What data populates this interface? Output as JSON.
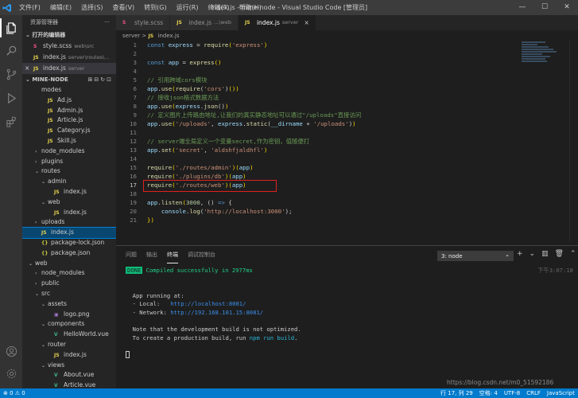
{
  "titlebar": {
    "menu": [
      "文件(F)",
      "编辑(E)",
      "选择(S)",
      "查看(V)",
      "转到(G)",
      "运行(R)",
      "终端(T)",
      "帮助(H)"
    ],
    "title": "index.js - mine-node - Visual Studio Code [管理员]",
    "controls": [
      "—",
      "☐",
      "✕"
    ]
  },
  "activity_icons": [
    "files-icon",
    "search-icon",
    "source-control-icon",
    "run-debug-icon",
    "extensions-icon",
    "account-icon",
    "settings-gear-icon"
  ],
  "sidebar": {
    "header": "资源管理器",
    "header_more": "···",
    "open_editors_label": "打开的编辑器",
    "open_editors": [
      {
        "name": "style.scss",
        "desc": "web\\src",
        "icon": "S"
      },
      {
        "name": "index.js",
        "desc": "server\\routes\\...",
        "icon": "JS"
      },
      {
        "name": "index.js",
        "desc": "server",
        "icon": "JS"
      }
    ],
    "project_label": "MINE-NODE",
    "project_tools": "⊞⊟↻⊡",
    "tree": [
      {
        "label": "modes",
        "icon": "",
        "chev": "",
        "indent": 2
      },
      {
        "label": "Ad.js",
        "icon": "JS",
        "chev": "",
        "indent": 3
      },
      {
        "label": "Admin.js",
        "icon": "JS",
        "chev": "",
        "indent": 3
      },
      {
        "label": "Article.js",
        "icon": "JS",
        "chev": "",
        "indent": 3
      },
      {
        "label": "Category.js",
        "icon": "JS",
        "chev": "",
        "indent": 3
      },
      {
        "label": "Skill.js",
        "icon": "JS",
        "chev": "",
        "indent": 3
      },
      {
        "label": "node_modules",
        "icon": "",
        "chev": "›",
        "indent": 2
      },
      {
        "label": "plugins",
        "icon": "",
        "chev": "›",
        "indent": 2
      },
      {
        "label": "routes",
        "icon": "",
        "chev": "⌄",
        "indent": 2
      },
      {
        "label": "admin",
        "icon": "",
        "chev": "⌄",
        "indent": 3
      },
      {
        "label": "index.js",
        "icon": "JS",
        "chev": "",
        "indent": 4
      },
      {
        "label": "web",
        "icon": "",
        "chev": "⌄",
        "indent": 3
      },
      {
        "label": "index.js",
        "icon": "JS",
        "chev": "",
        "indent": 4
      },
      {
        "label": "uploads",
        "icon": "",
        "chev": "›",
        "indent": 2
      },
      {
        "label": "index.js",
        "icon": "JS",
        "chev": "",
        "indent": 2,
        "selected": true
      },
      {
        "label": "package-lock.json",
        "icon": "{}",
        "chev": "",
        "indent": 2
      },
      {
        "label": "package.json",
        "icon": "{}",
        "chev": "",
        "indent": 2
      },
      {
        "label": "web",
        "icon": "",
        "chev": "⌄",
        "indent": 1
      },
      {
        "label": "node_modules",
        "icon": "",
        "chev": "›",
        "indent": 2
      },
      {
        "label": "public",
        "icon": "",
        "chev": "›",
        "indent": 2
      },
      {
        "label": "src",
        "icon": "",
        "chev": "⌄",
        "indent": 2
      },
      {
        "label": "assets",
        "icon": "",
        "chev": "⌄",
        "indent": 3
      },
      {
        "label": "logo.png",
        "icon": "▣",
        "chev": "",
        "indent": 4
      },
      {
        "label": "components",
        "icon": "",
        "chev": "⌄",
        "indent": 3
      },
      {
        "label": "HelloWorld.vue",
        "icon": "V",
        "chev": "",
        "indent": 4
      },
      {
        "label": "router",
        "icon": "",
        "chev": "⌄",
        "indent": 3
      },
      {
        "label": "index.js",
        "icon": "JS",
        "chev": "",
        "indent": 4
      },
      {
        "label": "views",
        "icon": "",
        "chev": "⌄",
        "indent": 3
      },
      {
        "label": "About.vue",
        "icon": "V",
        "chev": "",
        "indent": 4
      },
      {
        "label": "Article.vue",
        "icon": "V",
        "chev": "",
        "indent": 4
      }
    ]
  },
  "tabs": [
    {
      "name": "style.scss",
      "desc": "",
      "icon": "S",
      "active": false
    },
    {
      "name": "index.js",
      "desc": "...\\web",
      "icon": "JS",
      "active": false
    },
    {
      "name": "index.js",
      "desc": "server",
      "icon": "JS",
      "active": true
    }
  ],
  "tab_close": "×",
  "breadcrumb": {
    "folder": "server",
    "sep": ">",
    "file": "index.js"
  },
  "code_lines": [
    {
      "n": "1",
      "tokens": [
        [
          "kw",
          "const "
        ],
        [
          "var",
          "express"
        ],
        [
          "pl",
          " = "
        ],
        [
          "fn",
          "require"
        ],
        [
          "br",
          "("
        ],
        [
          "str",
          "'express'"
        ],
        [
          "br",
          ")"
        ]
      ]
    },
    {
      "n": "2",
      "tokens": []
    },
    {
      "n": "3",
      "tokens": [
        [
          "kw",
          "const "
        ],
        [
          "var",
          "app"
        ],
        [
          "pl",
          " = "
        ],
        [
          "fn",
          "express"
        ],
        [
          "br",
          "()"
        ]
      ]
    },
    {
      "n": "4",
      "tokens": []
    },
    {
      "n": "5",
      "tokens": [
        [
          "cm",
          "// 引用跨域cors模块"
        ]
      ]
    },
    {
      "n": "6",
      "tokens": [
        [
          "var",
          "app"
        ],
        [
          "pl",
          "."
        ],
        [
          "fn",
          "use"
        ],
        [
          "br",
          "("
        ],
        [
          "fn",
          "require"
        ],
        [
          "pl",
          "("
        ],
        [
          "str",
          "'cors'"
        ],
        [
          "pl",
          ")"
        ],
        [
          "br",
          "()"
        ],
        [
          "br",
          ")"
        ]
      ]
    },
    {
      "n": "7",
      "tokens": [
        [
          "cm",
          "// 接收json格式数据方法"
        ]
      ]
    },
    {
      "n": "8",
      "tokens": [
        [
          "var",
          "app"
        ],
        [
          "pl",
          "."
        ],
        [
          "fn",
          "use"
        ],
        [
          "br",
          "("
        ],
        [
          "var",
          "express"
        ],
        [
          "pl",
          "."
        ],
        [
          "fn",
          "json"
        ],
        [
          "pl",
          "()"
        ],
        [
          "br",
          ")"
        ]
      ]
    },
    {
      "n": "9",
      "tokens": [
        [
          "cm",
          "// 定义图片上传路由地址,让我们的真实静态地址可以通过\"/uploads\"直接访问"
        ]
      ]
    },
    {
      "n": "10",
      "tokens": [
        [
          "var",
          "app"
        ],
        [
          "pl",
          "."
        ],
        [
          "fn",
          "use"
        ],
        [
          "br",
          "("
        ],
        [
          "str",
          "'/uploads'"
        ],
        [
          "pl",
          ", "
        ],
        [
          "var",
          "express"
        ],
        [
          "pl",
          "."
        ],
        [
          "fn",
          "static"
        ],
        [
          "pl",
          "("
        ],
        [
          "var",
          "__dirname"
        ],
        [
          "pl",
          " + "
        ],
        [
          "str",
          "'/uploads'"
        ],
        [
          "pl",
          ")"
        ],
        [
          "br",
          ")"
        ]
      ]
    },
    {
      "n": "11",
      "tokens": []
    },
    {
      "n": "12",
      "tokens": [
        [
          "cm",
          "// server端全局定义一个变量secret,作为密钥，值随便打"
        ]
      ]
    },
    {
      "n": "13",
      "tokens": [
        [
          "var",
          "app"
        ],
        [
          "pl",
          "."
        ],
        [
          "fn",
          "set"
        ],
        [
          "br",
          "("
        ],
        [
          "str",
          "'secret'"
        ],
        [
          "pl",
          ", "
        ],
        [
          "str",
          "'aldshfjaldhfl'"
        ],
        [
          "br",
          ")"
        ]
      ]
    },
    {
      "n": "14",
      "tokens": []
    },
    {
      "n": "15",
      "tokens": [
        [
          "fn",
          "require"
        ],
        [
          "br",
          "("
        ],
        [
          "str",
          "'./routes/admin'"
        ],
        [
          "br",
          ")"
        ],
        [
          "br",
          "("
        ],
        [
          "var",
          "app"
        ],
        [
          "br",
          ")"
        ]
      ]
    },
    {
      "n": "16",
      "tokens": [
        [
          "fn",
          "require"
        ],
        [
          "br",
          "("
        ],
        [
          "str",
          "'./plugins/db'"
        ],
        [
          "br",
          ")"
        ],
        [
          "br",
          "("
        ],
        [
          "var",
          "app"
        ],
        [
          "br",
          ")"
        ]
      ]
    },
    {
      "n": "17",
      "tokens": [
        [
          "fn",
          "require"
        ],
        [
          "br",
          "("
        ],
        [
          "str",
          "'./routes/web'"
        ],
        [
          "br",
          ")"
        ],
        [
          "br",
          "("
        ],
        [
          "var",
          "app"
        ],
        [
          "br",
          ")"
        ]
      ],
      "current": true
    },
    {
      "n": "18",
      "tokens": []
    },
    {
      "n": "19",
      "tokens": [
        [
          "var",
          "app"
        ],
        [
          "pl",
          "."
        ],
        [
          "fn",
          "listen"
        ],
        [
          "br",
          "("
        ],
        [
          "num",
          "3000"
        ],
        [
          "pl",
          ", () "
        ],
        [
          "kw",
          "=>"
        ],
        [
          "pl",
          " {"
        ]
      ]
    },
    {
      "n": "20",
      "tokens": [
        [
          "pl",
          "    "
        ],
        [
          "var",
          "console"
        ],
        [
          "pl",
          "."
        ],
        [
          "fn",
          "log"
        ],
        [
          "pl",
          "("
        ],
        [
          "str",
          "'http://localhost:3000'"
        ],
        [
          "pl",
          ");"
        ]
      ]
    },
    {
      "n": "21",
      "tokens": [
        [
          "br",
          "})"
        ]
      ]
    }
  ],
  "panel": {
    "tabs": [
      "问题",
      "输出",
      "终端",
      "调试控制台"
    ],
    "active_tab": 2,
    "terminal_select": "3: node",
    "tools": [
      "+",
      "⌄",
      "▥",
      "🗑",
      "⌃",
      "✕"
    ],
    "timestamp": "下午3:07:18",
    "done_badge": "DONE",
    "compiled": "Compiled successfully in 2977ms",
    "running": "App running at:",
    "local_label": "- Local:   ",
    "local_url": "http://localhost:8081/",
    "network_label": "- Network: ",
    "network_url": "http://192.168.101.15:8081/",
    "note1": "Note that the development build is not optimized.",
    "note2_pre": "To create a production build, run ",
    "note2_cmd": "npm run build",
    "note2_post": "."
  },
  "status": {
    "left": "⊗ 0  ⚠ 0",
    "items": [
      "行 17, 列 29",
      "空格: 4",
      "UTF-8",
      "CRLF",
      "JavaScript"
    ]
  },
  "watermark": "https://blog.csdn.net/m0_51592186"
}
